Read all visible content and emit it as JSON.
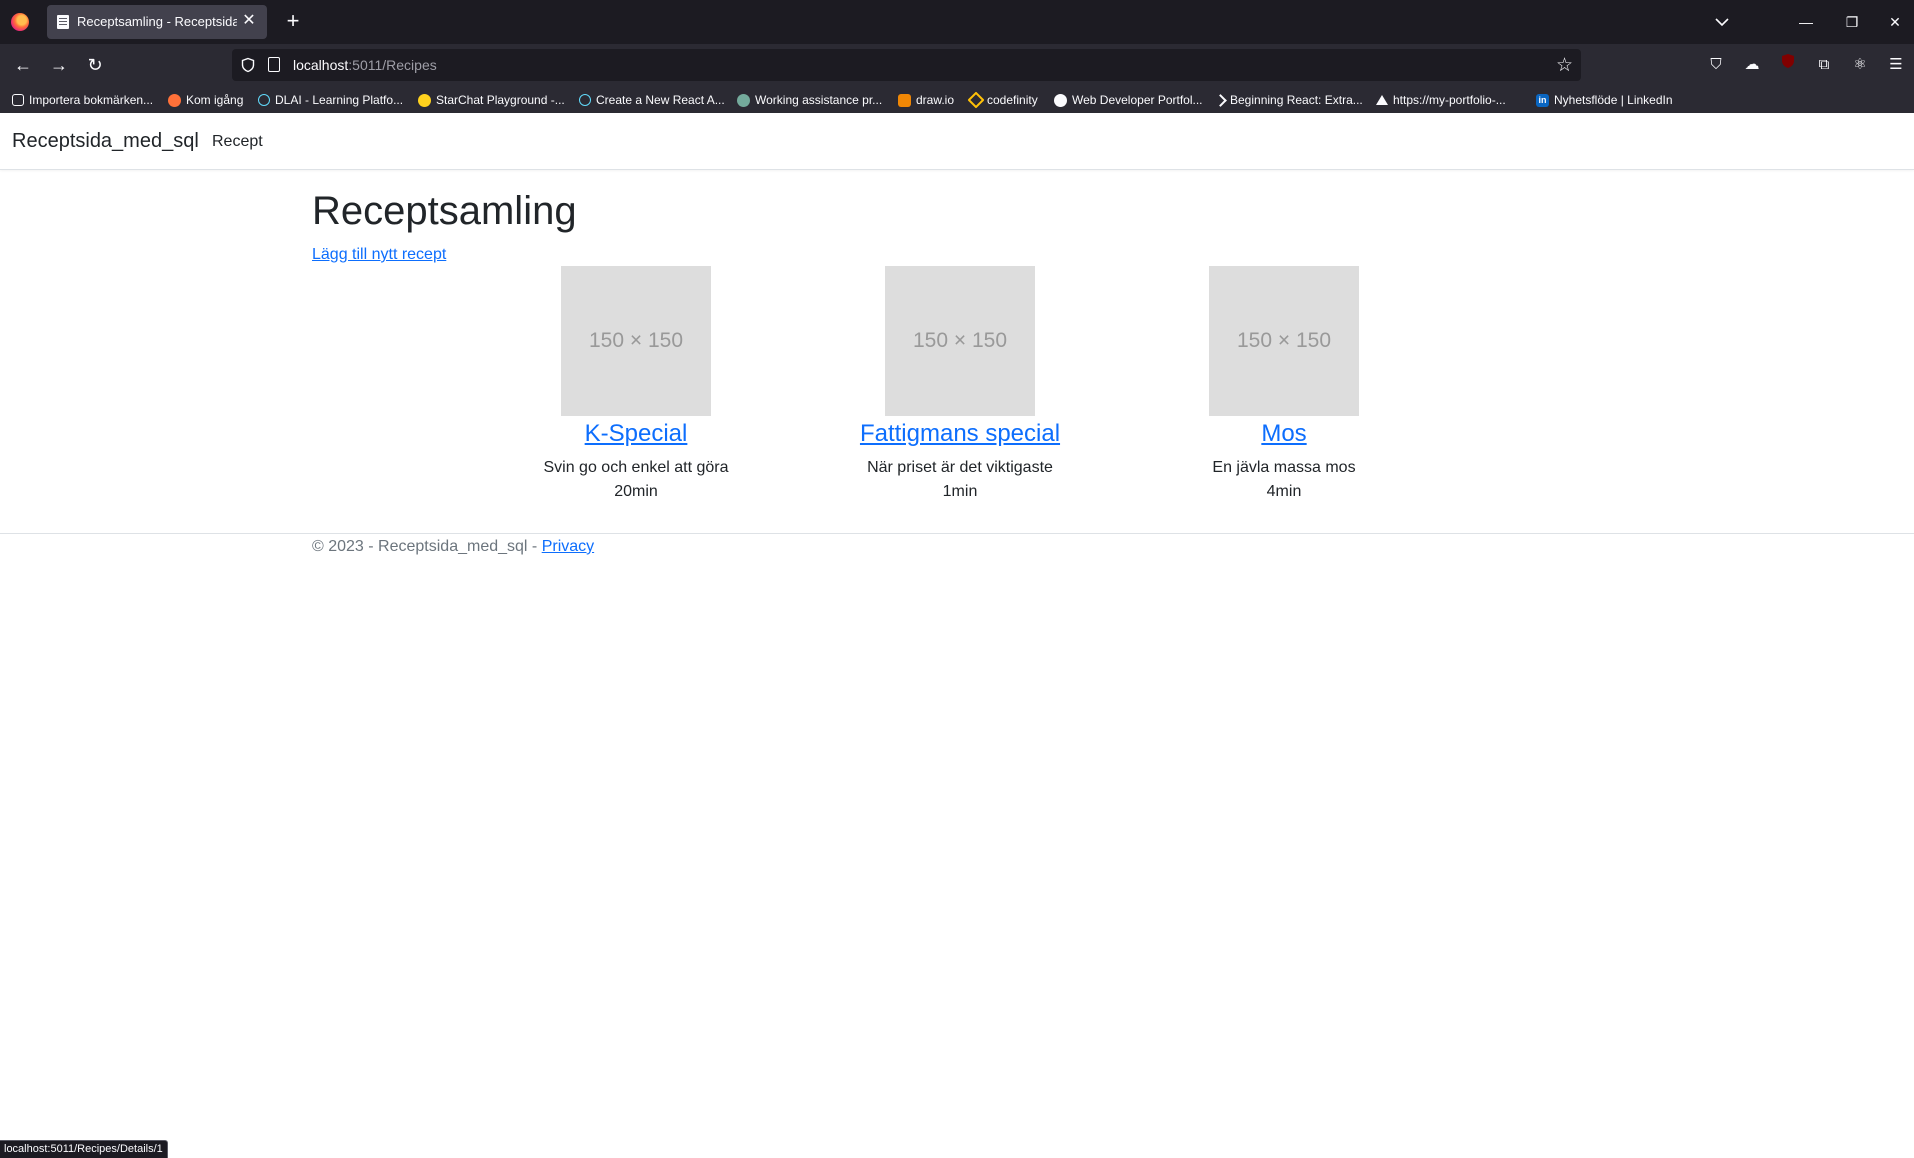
{
  "browser": {
    "tab_title": "Receptsamling - Receptsida_med_sql",
    "url_host": "localhost",
    "url_rest": ":5011/Recipes",
    "bookmarks": [
      {
        "label": "Importera bokmärken...",
        "color": "#fbfbfe"
      },
      {
        "label": "Kom igång",
        "color": "#ff7139"
      },
      {
        "label": "DLAI - Learning Platfo...",
        "color": "#61dafb"
      },
      {
        "label": "StarChat Playground -...",
        "color": "#ffd21e"
      },
      {
        "label": "Create a New React A...",
        "color": "#61dafb"
      },
      {
        "label": "Working assistance pr...",
        "color": "#74aa9c"
      },
      {
        "label": "draw.io",
        "color": "#f08705"
      },
      {
        "label": "codefinity",
        "color": "#ffc107"
      },
      {
        "label": "Web Developer Portfol...",
        "color": "#e74c3c"
      },
      {
        "label": "Beginning React: Extra...",
        "color": "#fbfbfe"
      },
      {
        "label": "https://my-portfolio-...",
        "color": "#fbfbfe"
      },
      {
        "label": "Nyhetsflöde | LinkedIn",
        "color": "#0a66c2"
      }
    ],
    "status_text": "localhost:5011/Recipes/Details/1"
  },
  "header": {
    "brand": "Receptsida_med_sql",
    "nav_recept": "Recept"
  },
  "main": {
    "title": "Receptsamling",
    "add_link": "Lägg till nytt recept",
    "recipes": [
      {
        "placeholder": "150 × 150",
        "name": "K-Special",
        "description": "Svin go och enkel att göra",
        "time": "20min"
      },
      {
        "placeholder": "150 × 150",
        "name": "Fattigmans special",
        "description": "När priset är det viktigaste",
        "time": "1min"
      },
      {
        "placeholder": "150 × 150",
        "name": "Mos",
        "description": "En jävla massa mos",
        "time": "4min"
      }
    ]
  },
  "footer": {
    "text": "© 2023 - Receptsida_med_sql - ",
    "privacy": "Privacy"
  },
  "colors": {
    "link": "#0d6efd",
    "chrome_dark": "#1c1b22",
    "chrome_mid": "#2b2a33"
  }
}
